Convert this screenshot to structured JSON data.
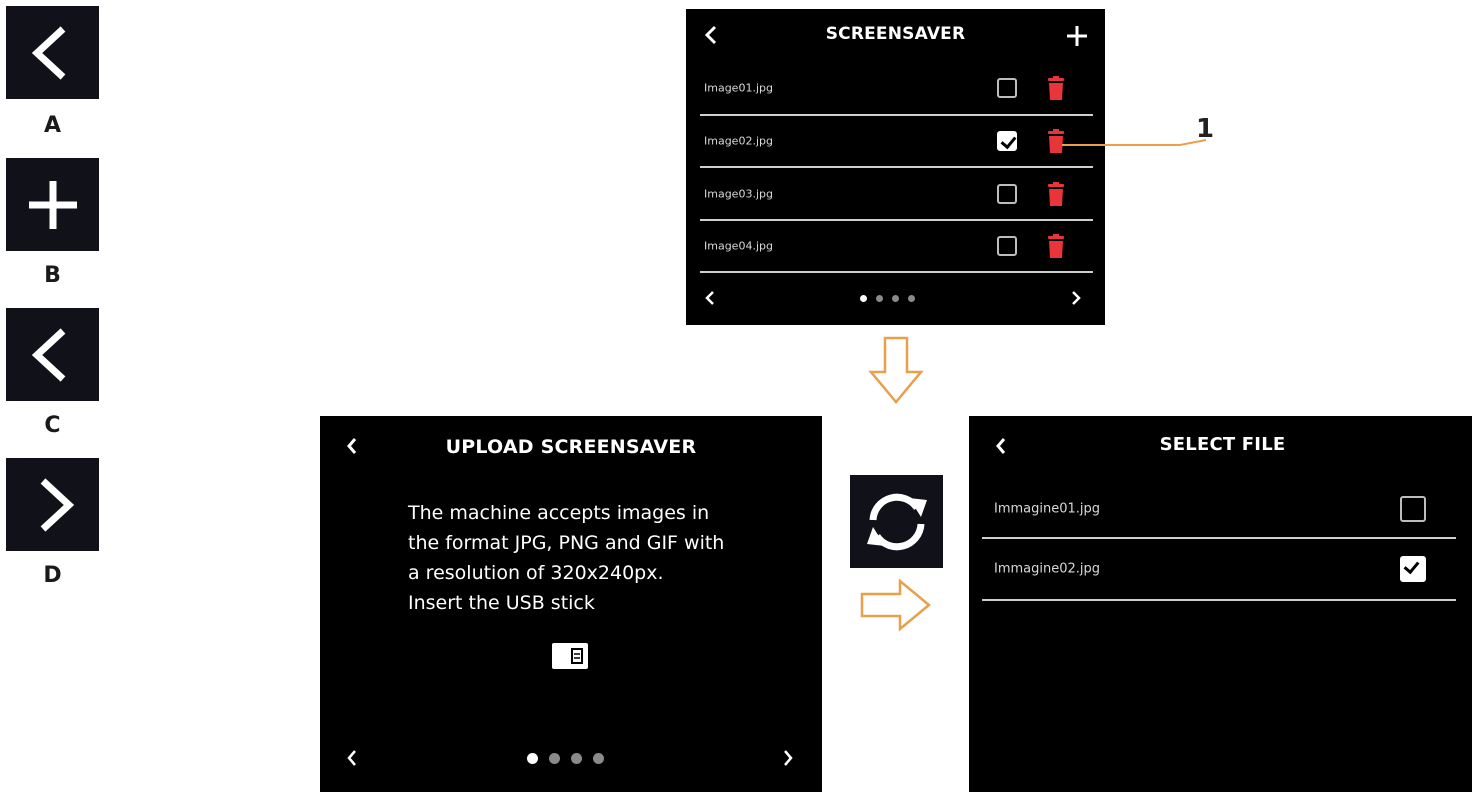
{
  "legend": [
    {
      "letter": "A",
      "icon": "chevron-left-icon"
    },
    {
      "letter": "B",
      "icon": "plus-icon"
    },
    {
      "letter": "C",
      "icon": "chevron-left-icon"
    },
    {
      "letter": "D",
      "icon": "chevron-right-icon"
    }
  ],
  "screensaver": {
    "title": "SCREENSAVER",
    "files": [
      {
        "name": "Image01.jpg",
        "checked": false
      },
      {
        "name": "Image02.jpg",
        "checked": true
      },
      {
        "name": "Image03.jpg",
        "checked": false
      },
      {
        "name": "Image04.jpg",
        "checked": false
      }
    ],
    "callout_label": "1",
    "pages": 4,
    "active_page": 1
  },
  "upload": {
    "title": "UPLOAD SCREENSAVER",
    "message_lines": [
      "The machine accepts images in",
      "the format JPG, PNG and GIF with",
      "a resolution of 320x240px.",
      "Insert the USB stick"
    ],
    "icon": "usb-stick-icon",
    "pages": 4,
    "active_page": 1
  },
  "select_file": {
    "title": "SELECT FILE",
    "files": [
      {
        "name": "Immagine01.jpg",
        "checked": false
      },
      {
        "name": "Immagine02.jpg",
        "checked": true
      }
    ]
  },
  "colors": {
    "screen_bg": "#000000",
    "tile_bg": "#111119",
    "delete_red": "#e8353a",
    "arrow_orange": "#e8a04a"
  }
}
